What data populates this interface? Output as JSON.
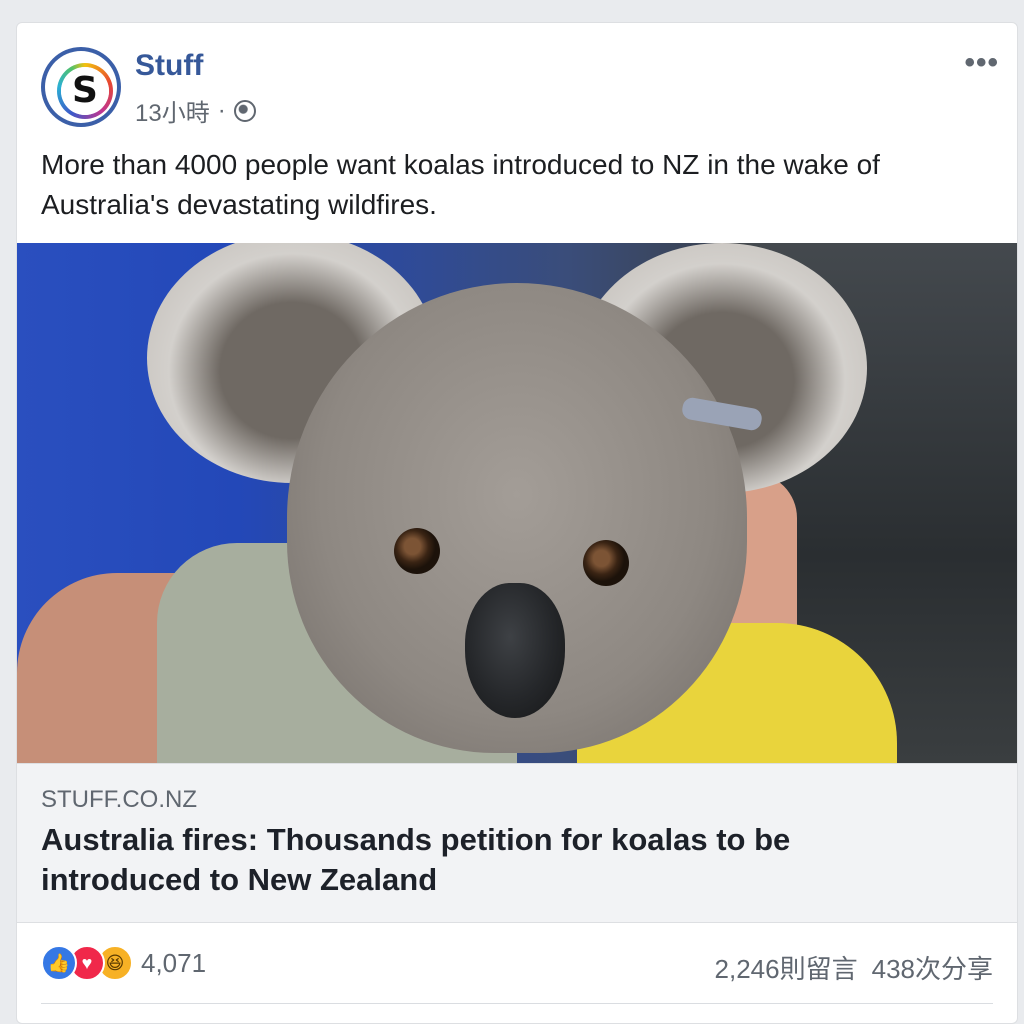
{
  "post": {
    "page_name": "Stuff",
    "avatar_letter": "S",
    "time": "13小時",
    "separator": "·",
    "more": "•••",
    "text": "More than 4000 people want koalas introduced to NZ in the wake of Australia's devastating wildfires."
  },
  "link": {
    "domain": "STUFF.CO.NZ",
    "title": "Australia fires: Thousands petition for koalas to be introduced to New Zealand"
  },
  "engagement": {
    "reaction_count": "4,071",
    "comments": "2,246則留言",
    "shares": "438次分享",
    "reaction_icons": [
      "like-icon",
      "love-icon",
      "haha-icon"
    ]
  },
  "colors": {
    "brand_blue": "#365899",
    "text": "#1c1e21",
    "muted": "#606770"
  }
}
